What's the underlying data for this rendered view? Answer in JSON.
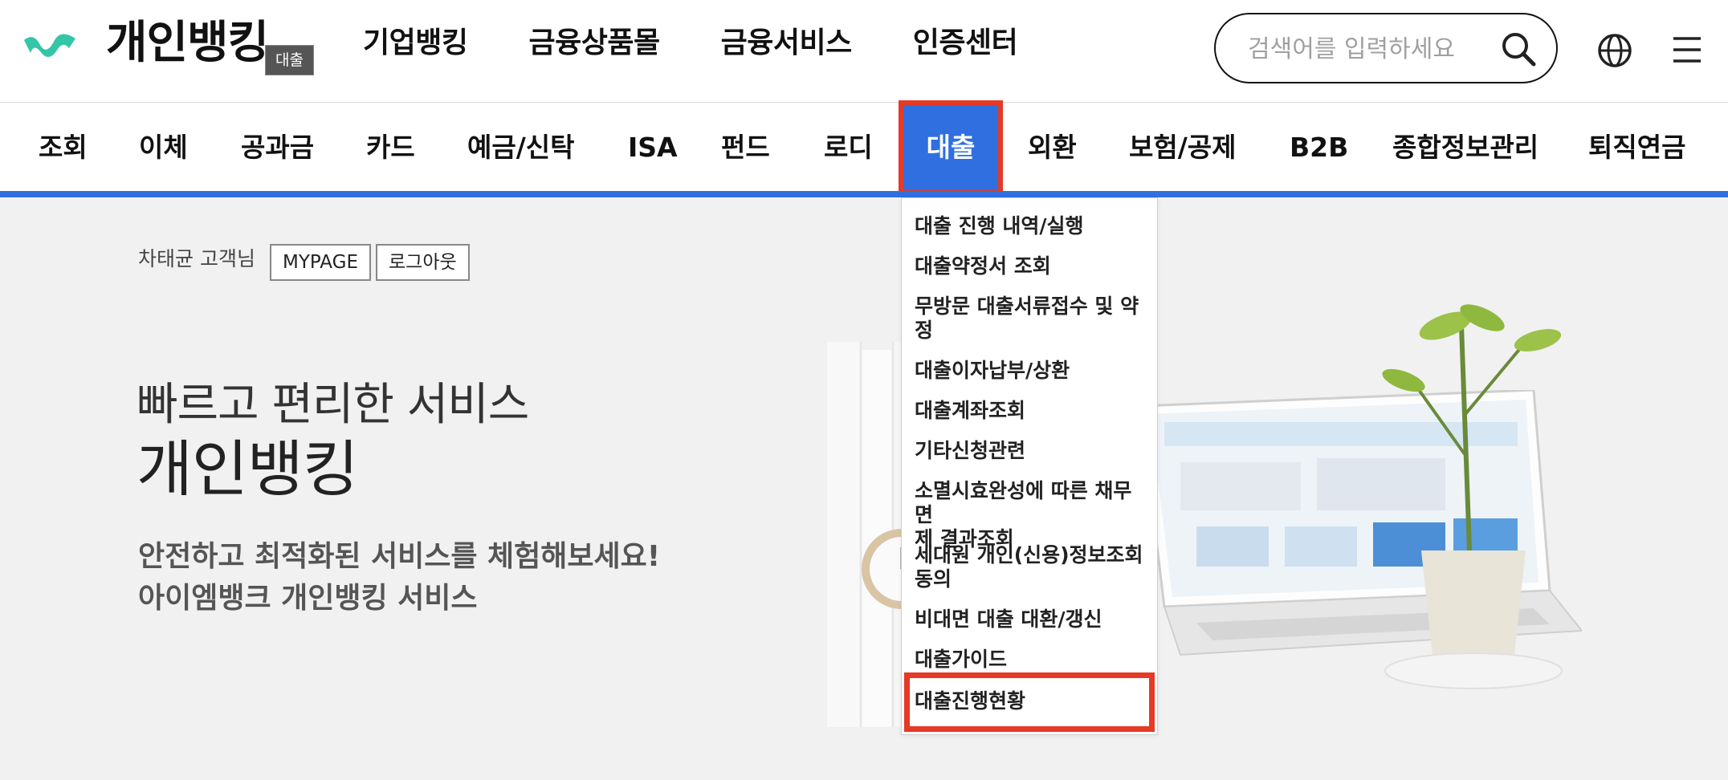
{
  "header": {
    "brand": "개인뱅킹",
    "tooltip": "대출",
    "top_nav": [
      "기업뱅킹",
      "금융상품몰",
      "금융서비스",
      "인증센터"
    ],
    "search": {
      "placeholder": "검색어를 입력하세요"
    }
  },
  "main_nav": {
    "items": [
      "조회",
      "이체",
      "공과금",
      "카드",
      "예금/신탁",
      "ISA",
      "펀드",
      "로디",
      "대출",
      "외환",
      "보험/공제",
      "B2B",
      "종합정보관리",
      "퇴직연금"
    ],
    "active": "대출"
  },
  "hero": {
    "user_greeting": "차태균 고객님",
    "mypage_label": "MYPAGE",
    "logout_label": "로그아웃",
    "title_line1": "빠르고 편리한 서비스",
    "title_line2": "개인뱅킹",
    "subtitle_line1": "안전하고 최적화된 서비스를 체험해보세요!",
    "subtitle_line2": "아이엠뱅크 개인뱅킹 서비스"
  },
  "dropdown": {
    "items": [
      {
        "line1": "대출 진행 내역/실행",
        "line2": ""
      },
      {
        "line1": "대출약정서 조회",
        "line2": ""
      },
      {
        "line1": "무방문 대출서류접수 및 약",
        "line2": "정"
      },
      {
        "line1": "대출이자납부/상환",
        "line2": ""
      },
      {
        "line1": "대출계좌조회",
        "line2": ""
      },
      {
        "line1": "기타신청관련",
        "line2": ""
      },
      {
        "line1": "소멸시효완성에 따른 채무면",
        "line2": "제 결과조회"
      },
      {
        "line1": "세대원 개인(신용)정보조회",
        "line2": "동의"
      },
      {
        "line1": "비대면 대출 대환/갱신",
        "line2": ""
      },
      {
        "line1": "대출가이드",
        "line2": ""
      },
      {
        "line1": "대출진행현황",
        "line2": ""
      }
    ]
  },
  "colors": {
    "accent": "#2f6fe0",
    "highlight": "#e43a26",
    "logo": "#34c6a6"
  }
}
